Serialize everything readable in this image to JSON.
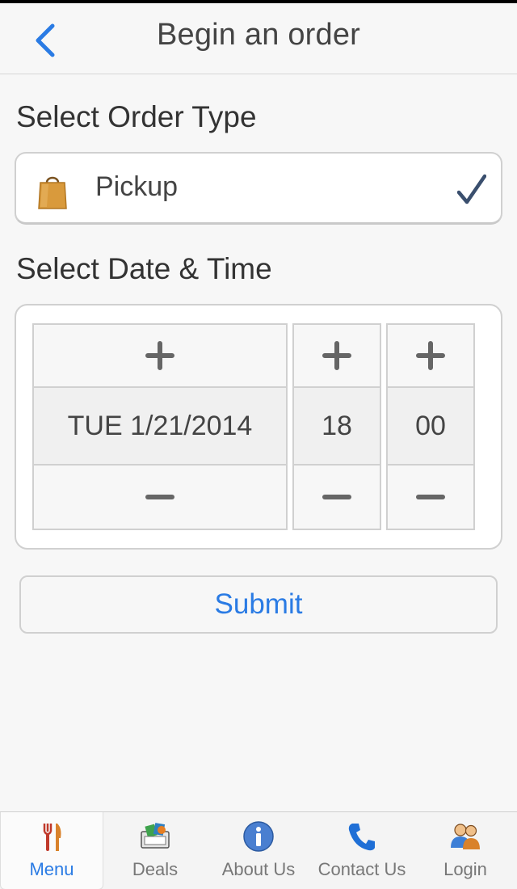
{
  "nav": {
    "title": "Begin an order",
    "back_icon": "chevron-left-icon"
  },
  "order_type": {
    "heading": "Select Order Type",
    "selected_label": "Pickup",
    "icon": "shopping-bag-icon",
    "check_icon": "checkmark-icon"
  },
  "datetime": {
    "heading": "Select Date & Time",
    "date": "TUE 1/21/2014",
    "hour": "18",
    "minute": "00",
    "increment_icon": "plus-icon",
    "decrement_icon": "minus-icon"
  },
  "submit": {
    "label": "Submit"
  },
  "tabbar": {
    "items": [
      {
        "label": "Menu",
        "icon": "fork-knife-icon",
        "active": true
      },
      {
        "label": "Deals",
        "icon": "deals-icon",
        "active": false
      },
      {
        "label": "About Us",
        "icon": "info-icon",
        "active": false
      },
      {
        "label": "Contact Us",
        "icon": "phone-icon",
        "active": false
      },
      {
        "label": "Login",
        "icon": "users-icon",
        "active": false
      }
    ]
  },
  "colors": {
    "accent": "#2a7be4",
    "background": "#f7f7f7",
    "check": "#3a4f6e",
    "bag": "#d99a3c"
  }
}
